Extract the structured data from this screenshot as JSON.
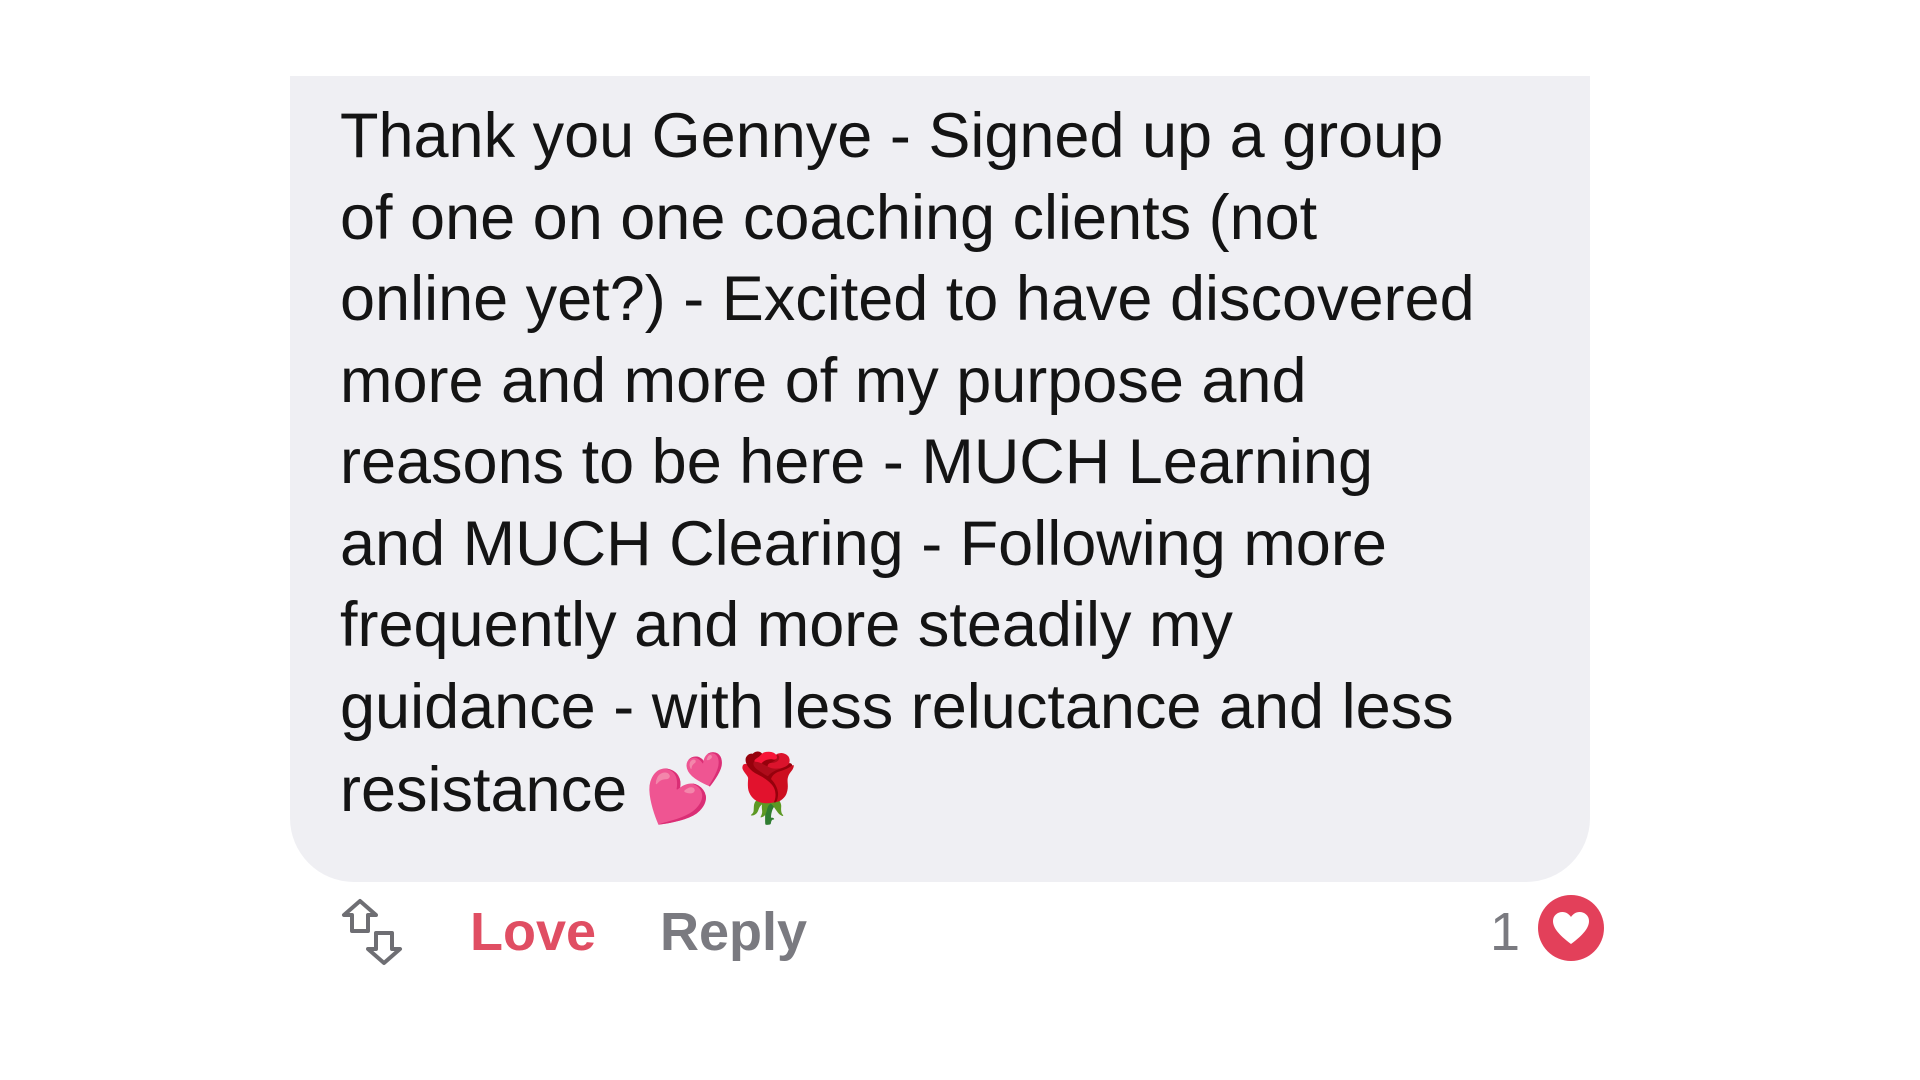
{
  "comment": {
    "text": "Thank you Gennye - Signed up a group\nof one on one coaching clients (not\nonline yet?) - Excited to have discovered\nmore and more of my purpose and\nreasons to be here -  MUCH Learning\nand MUCH Clearing -  Following more\nfrequently and more steadily my\nguidance - with less reluctance and less\nresistance",
    "emojis": "💕🌹"
  },
  "actions": {
    "share_icon": "share-arrows-icon",
    "love_label": "Love",
    "reply_label": "Reply",
    "reaction_count": "1",
    "reaction_icon": "heart-icon"
  },
  "colors": {
    "bubble_bg": "#efeff3",
    "love": "#e04e63",
    "reply": "#7a7a80",
    "heart_badge": "#e3405a"
  }
}
